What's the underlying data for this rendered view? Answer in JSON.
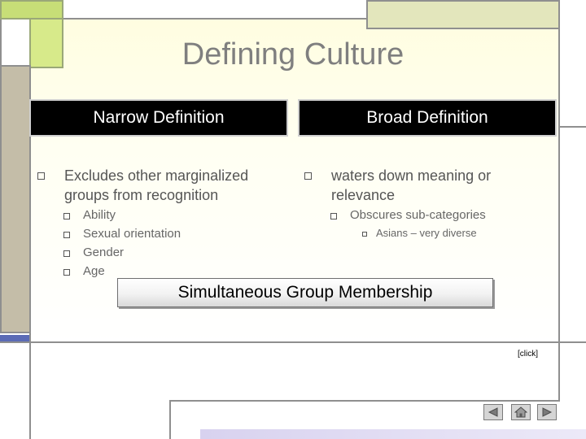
{
  "slide": {
    "title": "Defining Culture",
    "columns": {
      "narrow": {
        "header": "Narrow Definition",
        "bullet": "Excludes other marginalized groups from recognition",
        "sub_items": [
          "Ability",
          "Sexual orientation",
          "Gender",
          "Age"
        ]
      },
      "broad": {
        "header": "Broad Definition",
        "bullet": "waters down meaning or relevance",
        "sub_item": "Obscures sub-categories",
        "sub_sub_item": "Asians – very diverse"
      }
    },
    "callout": "Simultaneous Group Membership",
    "click_note": "[click]"
  },
  "nav": {
    "prev_icon": "triangle-left-icon",
    "home_icon": "home-icon",
    "next_icon": "triangle-right-icon"
  },
  "colors": {
    "title": "#7f7f7f",
    "header_bg": "#000000",
    "header_text": "#ffffff",
    "accent_green": "#d7ea8a",
    "accent_olive": "#e3e6bc",
    "accent_tan": "#c4bda8",
    "accent_blue": "#5b6bb6"
  }
}
